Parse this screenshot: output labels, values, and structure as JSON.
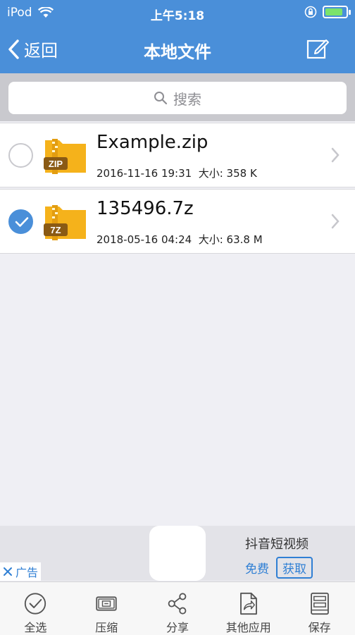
{
  "status": {
    "carrier": "iPod",
    "time": "上午5:18"
  },
  "nav": {
    "back_label": "返回",
    "title": "本地文件"
  },
  "search": {
    "placeholder": "搜索"
  },
  "files": [
    {
      "name": "Example.zip",
      "badge": "ZIP",
      "datetime": "2016-11-16 19:31",
      "size_label": "大小: 358 K",
      "checked": false
    },
    {
      "name": "135496.7z",
      "badge": "7Z",
      "datetime": "2018-05-16 04:24",
      "size_label": "大小: 63.8 M",
      "checked": true
    }
  ],
  "ad": {
    "badge": "广告",
    "app_name": "抖音短视频",
    "free_label": "免费",
    "get_label": "获取"
  },
  "toolbar": {
    "items": [
      {
        "label": "全选",
        "icon": "check-circle-icon"
      },
      {
        "label": "压缩",
        "icon": "compress-icon"
      },
      {
        "label": "分享",
        "icon": "share-icon"
      },
      {
        "label": "其他应用",
        "icon": "open-in-icon"
      },
      {
        "label": "保存",
        "icon": "save-icon"
      }
    ]
  },
  "colors": {
    "accent": "#4a8fd9",
    "folder": "#f5b21b",
    "link": "#2f7fd4"
  }
}
